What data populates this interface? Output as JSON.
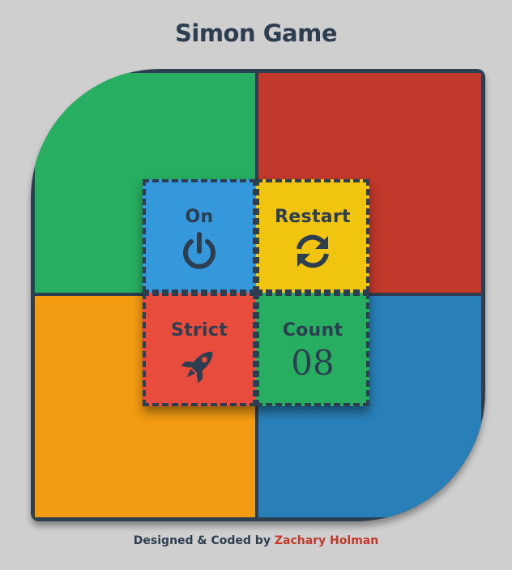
{
  "title": "Simon Game",
  "controls": {
    "on_label": "On",
    "restart_label": "Restart",
    "strict_label": "Strict",
    "count_label": "Count",
    "count_value": "08"
  },
  "footer": {
    "prefix": "Designed & Coded by",
    "author": "Zachary Holman"
  },
  "colors": {
    "background": "#cfcfcf",
    "dark": "#2c3e50",
    "green_pad": "#27ae60",
    "red_pad": "#c0392b",
    "orange_pad": "#f39c12",
    "blue_pad": "#2980b9",
    "on_button": "#3498db",
    "restart_button": "#f1c40f",
    "strict_button": "#e74c3c",
    "count_panel": "#27ae60"
  },
  "icons": {
    "on": "power-icon",
    "restart": "refresh-icon",
    "strict": "rocket-icon"
  }
}
